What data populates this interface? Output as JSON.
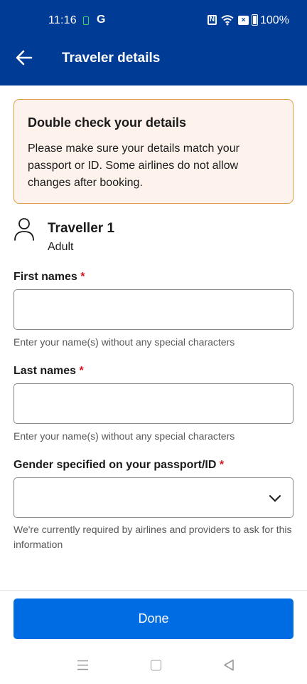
{
  "status_bar": {
    "time": "11:16",
    "g_label": "G",
    "nfc_label": "N",
    "battery": "100%"
  },
  "header": {
    "title": "Traveler details",
    "bg_color": "#003b95"
  },
  "notice": {
    "title": "Double check your details",
    "body": "Please make sure your details match your passport or ID. Some airlines do not allow changes after booking."
  },
  "traveller": {
    "name": "Traveller 1",
    "type": "Adult"
  },
  "form": {
    "first_names": {
      "label": "First names",
      "required_mark": "*",
      "value": "",
      "hint": "Enter your name(s) without any special characters"
    },
    "last_names": {
      "label": "Last names",
      "required_mark": "*",
      "value": "",
      "hint": "Enter your name(s) without any special characters"
    },
    "gender": {
      "label": "Gender specified on your passport/ID",
      "required_mark": "*",
      "selected": "",
      "hint": "We're currently required by airlines and providers to ask for this information"
    }
  },
  "footer": {
    "done_label": "Done",
    "button_color": "#006ce4"
  },
  "icons": [
    "back-arrow-icon",
    "person-icon",
    "chevron-down-icon",
    "wifi-icon",
    "battery-icon",
    "menu-icon",
    "home-icon",
    "nav-back-icon"
  ]
}
